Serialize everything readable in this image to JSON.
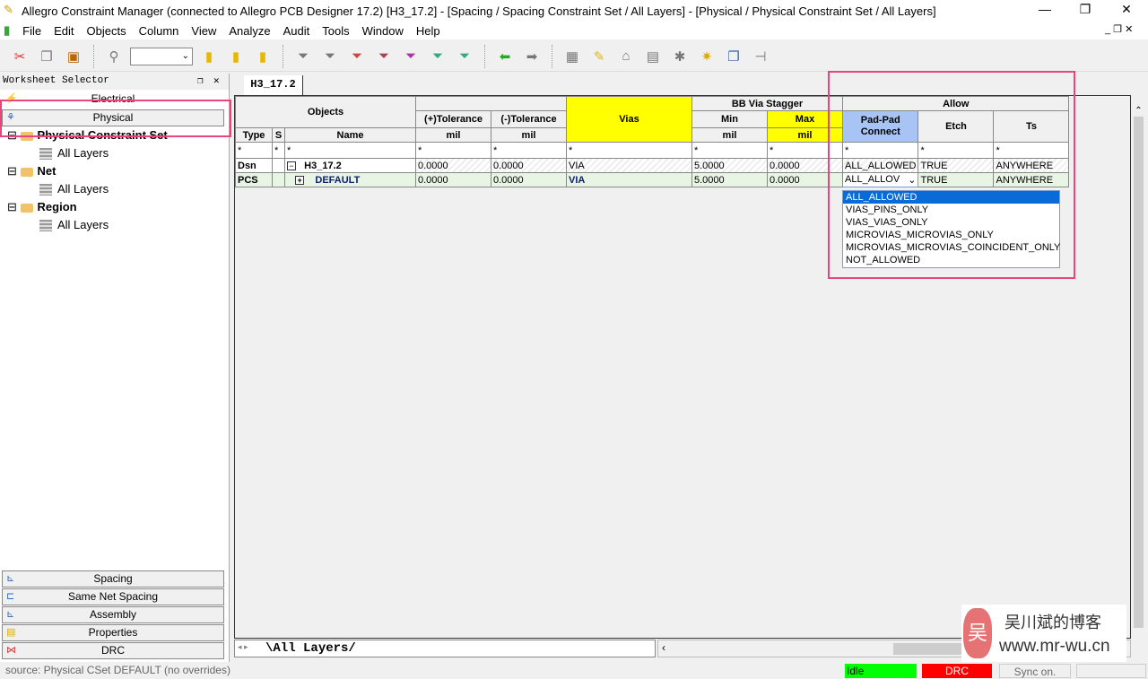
{
  "window": {
    "title": "Allegro Constraint Manager (connected to Allegro PCB Designer 17.2) [H3_17.2] - [Spacing / Spacing Constraint Set / All Layers] - [Physical / Physical Constraint Set / All Layers]",
    "minimize": "—",
    "restore": "❐",
    "close": "✕"
  },
  "menu": [
    "File",
    "Edit",
    "Objects",
    "Column",
    "View",
    "Analyze",
    "Audit",
    "Tools",
    "Window",
    "Help"
  ],
  "toolbar": {
    "combo_value": ""
  },
  "sidebar": {
    "title": "Worksheet Selector",
    "top_tabs": [
      "Electrical",
      "Physical"
    ],
    "tree": [
      {
        "label": "Physical Constraint Set",
        "child": "All Layers"
      },
      {
        "label": "Net",
        "child": "All Layers"
      },
      {
        "label": "Region",
        "child": "All Layers"
      }
    ],
    "bottom_tabs": [
      "Spacing",
      "Same Net Spacing",
      "Assembly",
      "Properties",
      "DRC"
    ]
  },
  "doc_tab": "H3_17.2",
  "table": {
    "group_headers": {
      "objects": "Objects",
      "vias": "Vias",
      "bb": "BB Via Stagger",
      "allow": "Allow"
    },
    "columns": {
      "type": "Type",
      "s": "S",
      "name": "Name",
      "ptol": "(+)Tolerance",
      "ntol": "(-)Tolerance",
      "min": "Min",
      "max": "Max",
      "padpad": "Pad-Pad Connect",
      "etch": "Etch",
      "ts": "Ts"
    },
    "unit": "mil",
    "filter": "*",
    "rows": [
      {
        "type": "Dsn",
        "s": "",
        "expander": "−",
        "name": "H3_17.2",
        "ptol": "0.0000",
        "ntol": "0.0000",
        "vias": "VIA",
        "min": "5.0000",
        "max": "0.0000",
        "padpad": "ALL_ALLOWED",
        "etch": "TRUE",
        "ts": "ANYWHERE"
      },
      {
        "type": "PCS",
        "s": "",
        "expander": "+",
        "name": "DEFAULT",
        "ptol": "0.0000",
        "ntol": "0.0000",
        "vias": "VIA",
        "min": "5.0000",
        "max": "0.0000",
        "padpad": "ALL_ALLOV",
        "etch": "TRUE",
        "ts": "ANYWHERE"
      }
    ]
  },
  "dropdown": {
    "selected": "ALL_ALLOWED",
    "options": [
      "ALL_ALLOWED",
      "VIAS_PINS_ONLY",
      "VIAS_VIAS_ONLY",
      "MICROVIAS_MICROVIAS_ONLY",
      "MICROVIAS_MICROVIAS_COINCIDENT_ONLY",
      "NOT_ALLOWED"
    ]
  },
  "sheet_tab": "All Layers",
  "status": {
    "source": "source: Physical CSet DEFAULT (no overrides)",
    "idle": "Idle",
    "drc": "DRC",
    "sync": "Sync on."
  },
  "colors": {
    "highlight": "#e8457a",
    "yellow": "#ffff00",
    "blue_header": "#a7c4f5",
    "idle": "#00ff00",
    "drc": "#ff0000"
  },
  "watermark": {
    "line1": "吴川斌的博客",
    "line2": "www.mr-wu.cn",
    "logo": "吴"
  }
}
